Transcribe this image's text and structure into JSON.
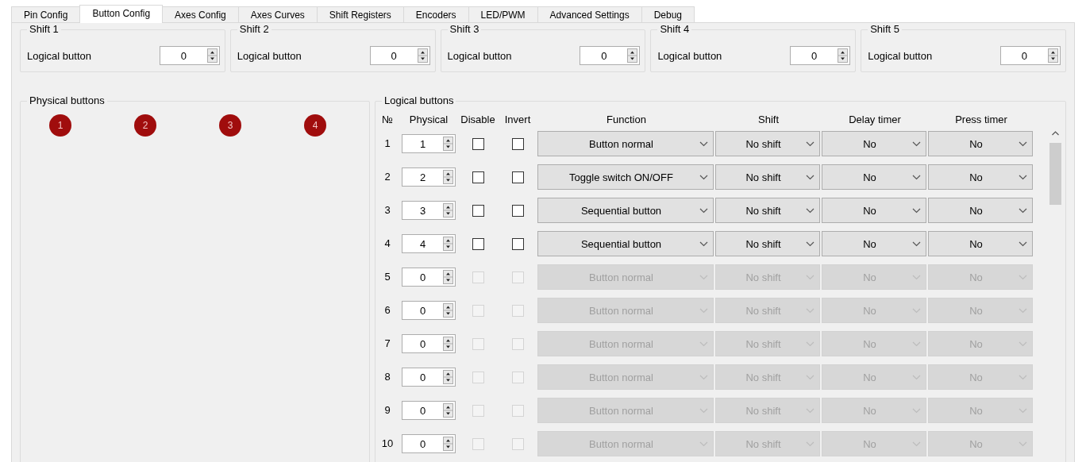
{
  "tabs": [
    {
      "label": "Pin Config",
      "selected": false
    },
    {
      "label": "Button Config",
      "selected": true
    },
    {
      "label": "Axes Config",
      "selected": false
    },
    {
      "label": "Axes Curves",
      "selected": false
    },
    {
      "label": "Shift Registers",
      "selected": false
    },
    {
      "label": "Encoders",
      "selected": false
    },
    {
      "label": "LED/PWM",
      "selected": false
    },
    {
      "label": "Advanced Settings",
      "selected": false
    },
    {
      "label": "Debug",
      "selected": false
    }
  ],
  "shifts": [
    {
      "title": "Shift 1",
      "label": "Logical button",
      "value": "0"
    },
    {
      "title": "Shift 2",
      "label": "Logical button",
      "value": "0"
    },
    {
      "title": "Shift 3",
      "label": "Logical button",
      "value": "0"
    },
    {
      "title": "Shift 4",
      "label": "Logical button",
      "value": "0"
    },
    {
      "title": "Shift 5",
      "label": "Logical button",
      "value": "0"
    }
  ],
  "physical_buttons": {
    "title": "Physical buttons",
    "buttons": [
      "1",
      "2",
      "3",
      "4"
    ]
  },
  "logical_buttons": {
    "title": "Logical buttons",
    "columns": [
      "№",
      "Physical",
      "Disable",
      "Invert",
      "Function",
      "Shift",
      "Delay timer",
      "Press timer"
    ],
    "rows": [
      {
        "number": "1",
        "physical": "1",
        "disable": false,
        "invert": false,
        "function": "Button normal",
        "shift": "No shift",
        "delay": "No",
        "press": "No",
        "disabled": false
      },
      {
        "number": "2",
        "physical": "2",
        "disable": false,
        "invert": false,
        "function": "Toggle switch ON/OFF",
        "shift": "No shift",
        "delay": "No",
        "press": "No",
        "disabled": false
      },
      {
        "number": "3",
        "physical": "3",
        "disable": false,
        "invert": false,
        "function": "Sequential button",
        "shift": "No shift",
        "delay": "No",
        "press": "No",
        "disabled": false
      },
      {
        "number": "4",
        "physical": "4",
        "disable": false,
        "invert": false,
        "function": "Sequential button",
        "shift": "No shift",
        "delay": "No",
        "press": "No",
        "disabled": false
      },
      {
        "number": "5",
        "physical": "0",
        "disable": false,
        "invert": false,
        "function": "Button normal",
        "shift": "No shift",
        "delay": "No",
        "press": "No",
        "disabled": true
      },
      {
        "number": "6",
        "physical": "0",
        "disable": false,
        "invert": false,
        "function": "Button normal",
        "shift": "No shift",
        "delay": "No",
        "press": "No",
        "disabled": true
      },
      {
        "number": "7",
        "physical": "0",
        "disable": false,
        "invert": false,
        "function": "Button normal",
        "shift": "No shift",
        "delay": "No",
        "press": "No",
        "disabled": true
      },
      {
        "number": "8",
        "physical": "0",
        "disable": false,
        "invert": false,
        "function": "Button normal",
        "shift": "No shift",
        "delay": "No",
        "press": "No",
        "disabled": true
      },
      {
        "number": "9",
        "physical": "0",
        "disable": false,
        "invert": false,
        "function": "Button normal",
        "shift": "No shift",
        "delay": "No",
        "press": "No",
        "disabled": true
      },
      {
        "number": "10",
        "physical": "0",
        "disable": false,
        "invert": false,
        "function": "Button normal",
        "shift": "No shift",
        "delay": "No",
        "press": "No",
        "disabled": true
      }
    ]
  }
}
